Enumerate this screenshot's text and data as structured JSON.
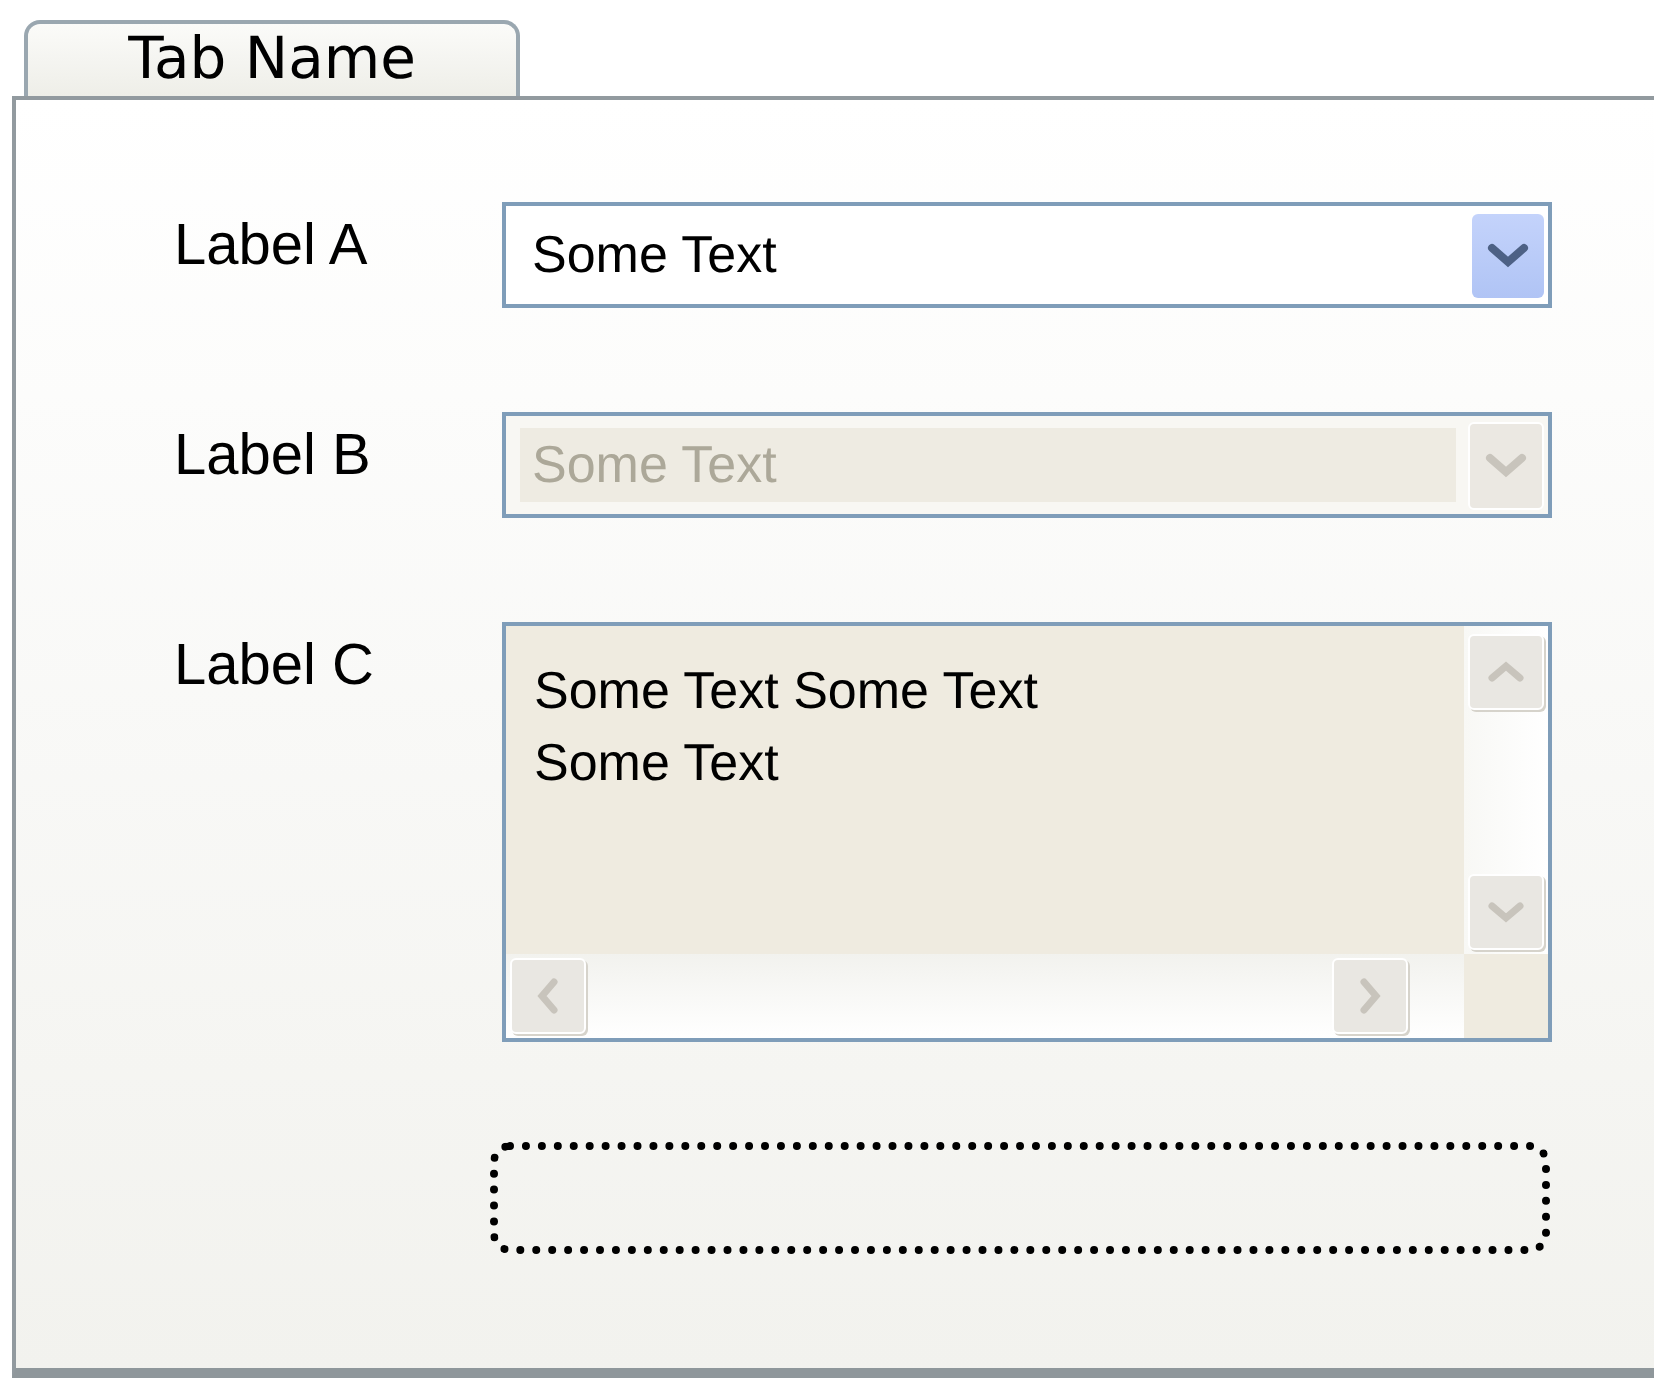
{
  "tab": {
    "label": "Tab Name",
    "selected": true
  },
  "fields": [
    {
      "kind": "dropdown",
      "label": "Label A",
      "value": "Some Text",
      "disabled": false
    },
    {
      "kind": "dropdown",
      "label": "Label B",
      "value": "Some Text",
      "disabled": true
    },
    {
      "kind": "textarea",
      "label": "Label C",
      "lines": [
        "Some Text Some Text",
        "Some Text"
      ],
      "disabled": true
    },
    {
      "kind": "dotted-area"
    }
  ]
}
